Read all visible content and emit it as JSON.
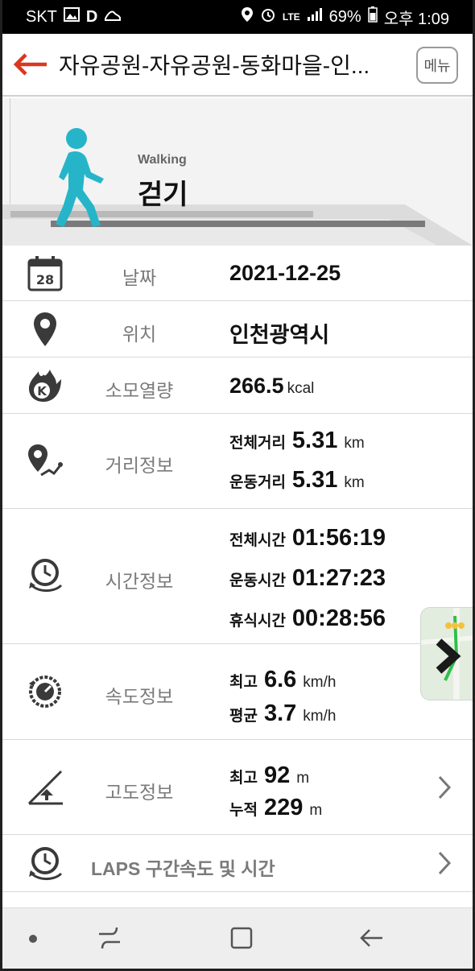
{
  "status_bar": {
    "carrier": "SKT",
    "battery": "69%",
    "time": "오후 1:09",
    "network": "LTE"
  },
  "app_bar": {
    "title": "자유공원-자유공원-동화마을-인...",
    "menu_label": "메뉴"
  },
  "activity": {
    "name_en": "Walking",
    "name_ko": "걷기",
    "figure_color": "#26b5c8"
  },
  "rows": {
    "date": {
      "label": "날짜",
      "value": "2021-12-25",
      "calendar_day": "28"
    },
    "location": {
      "label": "위치",
      "value": "인천광역시"
    },
    "calories": {
      "label": "소모열량",
      "value": "266.5",
      "unit": "kcal"
    },
    "distance": {
      "label": "거리정보",
      "items": [
        {
          "key": "전체거리",
          "value": "5.31",
          "unit": "km"
        },
        {
          "key": "운동거리",
          "value": "5.31",
          "unit": "km"
        }
      ]
    },
    "time": {
      "label": "시간정보",
      "items": [
        {
          "key": "전체시간",
          "value": "01:56:19"
        },
        {
          "key": "운동시간",
          "value": "01:27:23"
        },
        {
          "key": "휴식시간",
          "value": "00:28:56"
        }
      ]
    },
    "speed": {
      "label": "속도정보",
      "items": [
        {
          "key": "최고",
          "value": "6.6",
          "unit": "km/h"
        },
        {
          "key": "평균",
          "value": "3.7",
          "unit": "km/h"
        }
      ]
    },
    "altitude": {
      "label": "고도정보",
      "items": [
        {
          "key": "최고",
          "value": "92",
          "unit": "m"
        },
        {
          "key": "누적",
          "value": "229",
          "unit": "m"
        }
      ]
    },
    "laps": {
      "label": "LAPS 구간속도 및 시간"
    }
  },
  "colors": {
    "accent_back_arrow": "#d9381e",
    "icon_gray": "#3a3a3a",
    "label_gray": "#7a7a7a"
  }
}
